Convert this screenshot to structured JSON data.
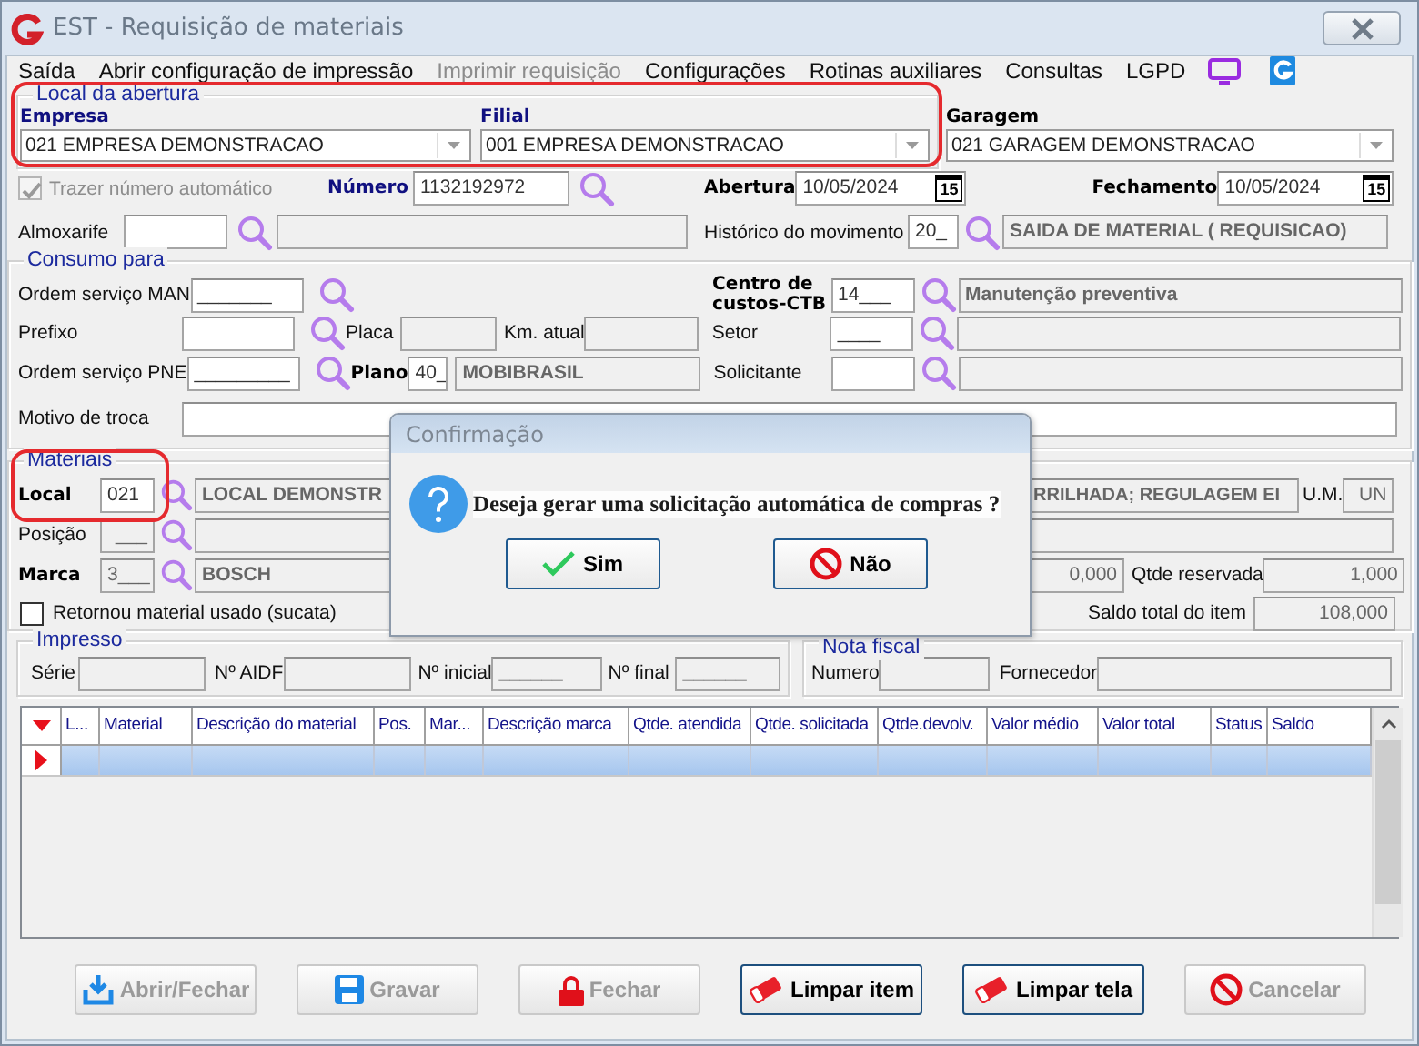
{
  "window": {
    "title": "EST - Requisição de materiais"
  },
  "menu": [
    {
      "label": "Saída",
      "disabled": false
    },
    {
      "label": "Abrir configuração de impressão",
      "disabled": false
    },
    {
      "label": "Imprimir requisição",
      "disabled": true
    },
    {
      "label": "Configurações",
      "disabled": false
    },
    {
      "label": "Rotinas auxiliares",
      "disabled": false
    },
    {
      "label": "Consultas",
      "disabled": false
    },
    {
      "label": "LGPD",
      "disabled": false
    }
  ],
  "local_da_abertura": {
    "legend": "Local da abertura",
    "empresa": {
      "label": "Empresa",
      "value": "021 EMPRESA DEMONSTRACAO"
    },
    "filial": {
      "label": "Filial",
      "value": "001 EMPRESA DEMONSTRACAO"
    }
  },
  "garagem": {
    "label": "Garagem",
    "value": "021 GARAGEM DEMONSTRACAO"
  },
  "trazer_numero_automatico": {
    "label": "Trazer número automático",
    "checked": true,
    "disabled": true
  },
  "numero": {
    "label": "Número",
    "field": {
      "value": "1132192972",
      "readonly": false
    }
  },
  "abertura": {
    "label": "Abertura",
    "value": "10/05/2024",
    "calendar": "15"
  },
  "fechamento": {
    "label": "Fechamento",
    "value": "10/05/2024",
    "calendar": "15"
  },
  "almoxarife": {
    "label": "Almoxarife",
    "field": {
      "readonly": false
    },
    "description": {
      "readonly": true
    }
  },
  "historico_do_movimento": {
    "label": "Histórico do movimento",
    "field": {
      "value": "20_",
      "readonly": false
    },
    "description": {
      "value": "SAIDA DE MATERIAL ( REQUISICAO)",
      "readonly": true
    }
  },
  "consumo_para": {
    "legend": "Consumo para",
    "ordem_servico_man": {
      "label": "Ordem serviço MAN",
      "field": {
        "value": "_______",
        "readonly": false
      }
    },
    "prefixo": {
      "label": "Prefixo",
      "field": {
        "readonly": false
      }
    },
    "placa": {
      "label": "Placa",
      "field": {
        "readonly": true
      }
    },
    "km_atual": {
      "label": "Km. atual",
      "field": {
        "readonly": true
      }
    },
    "ordem_servico_pne": {
      "label": "Ordem serviço PNE",
      "field": {
        "value": "_________",
        "readonly": false
      }
    },
    "plano": {
      "label": "Plano",
      "field": {
        "value": "40_",
        "readonly": false
      },
      "description": {
        "value": "MOBIBRASIL",
        "readonly": true
      }
    },
    "motivo_de_troca": {
      "label": "Motivo de troca",
      "field": {
        "readonly": false
      }
    },
    "centro_de_custos": {
      "label": "Centro de custos-CTB",
      "field": {
        "value": "14___",
        "readonly": false
      },
      "description": {
        "value": "Manutenção preventiva",
        "readonly": true
      }
    },
    "setor": {
      "label": "Setor",
      "field": {
        "value": "____",
        "readonly": false
      },
      "description": {
        "readonly": true
      }
    },
    "solicitante": {
      "label": "Solicitante",
      "field": {
        "readonly": false
      },
      "description": {
        "readonly": true
      }
    }
  },
  "materiais": {
    "legend": "Materiais",
    "local": {
      "label": "Local",
      "field": {
        "value": "021",
        "readonly": false
      },
      "description": {
        "value": "LOCAL DEMONSTR",
        "readonly": true
      }
    },
    "material_descricao": {
      "field": {
        "value": "RRILHADA; REGULAGEM EI",
        "readonly": true
      }
    },
    "unidade": {
      "label": "U.M.",
      "field": {
        "value": "UN",
        "readonly": true
      }
    },
    "posicao": {
      "label": "Posição",
      "field": {
        "value": "___",
        "readonly": true
      },
      "description": {
        "readonly": true
      }
    },
    "marca": {
      "label": "Marca",
      "field": {
        "value": "3___",
        "readonly": true
      },
      "description": {
        "value": "BOSCH",
        "readonly": true
      }
    },
    "quantidade": {
      "field": {
        "value": "0,000",
        "readonly": true
      }
    },
    "qtde_reservada": {
      "label": "Qtde reservada",
      "field": {
        "value": "1,000",
        "readonly": true
      }
    },
    "retornou_material_usado": {
      "label": "Retornou material usado (sucata)",
      "checked": false,
      "disabled": false
    },
    "saldo_total_do_item": {
      "label": "Saldo total do item",
      "field": {
        "value": "108,000",
        "readonly": true
      }
    }
  },
  "impresso": {
    "legend": "Impresso",
    "serie": {
      "label": "Série",
      "field": {
        "readonly": true
      }
    },
    "aidf": {
      "label": "Nº AIDF",
      "field": {
        "readonly": true
      }
    },
    "inicial": {
      "label": "Nº inicial",
      "field": {
        "value": "______",
        "readonly": true
      }
    },
    "final": {
      "label": "Nº final",
      "field": {
        "value": "______",
        "readonly": true
      }
    }
  },
  "nota_fiscal": {
    "legend": "Nota fiscal",
    "numero": {
      "label": "Numero",
      "field": {
        "readonly": true
      }
    },
    "fornecedor": {
      "label": "Fornecedor",
      "field": {
        "readonly": true
      }
    }
  },
  "table": {
    "columns": [
      "L...",
      "Material",
      "Descrição do material",
      "Pos.",
      "Mar...",
      "Descrição marca",
      "Qtde. atendida",
      "Qtde. solicitada",
      "Qtde.devolv.",
      "Valor médio",
      "Valor total",
      "Status",
      "Saldo"
    ],
    "rows": [
      {
        "selected": true
      }
    ]
  },
  "buttons": [
    {
      "label": "Abrir/Fechar",
      "kind": "download",
      "disabled": true
    },
    {
      "label": "Gravar",
      "kind": "floppy",
      "disabled": true
    },
    {
      "label": "Fechar",
      "kind": "lock",
      "disabled": true
    },
    {
      "label": "Limpar item",
      "kind": "eraser",
      "disabled": false
    },
    {
      "label": "Limpar tela",
      "kind": "eraser",
      "disabled": false
    },
    {
      "label": "Cancelar",
      "kind": "prohibit",
      "disabled": true
    }
  ],
  "dialog": {
    "title": "Confirmação",
    "message": "Deseja gerar uma solicitação automática de compras ?",
    "buttons": [
      {
        "label": "Sim",
        "kind": "confirm"
      },
      {
        "label": "Não",
        "kind": "prohibit"
      }
    ]
  }
}
